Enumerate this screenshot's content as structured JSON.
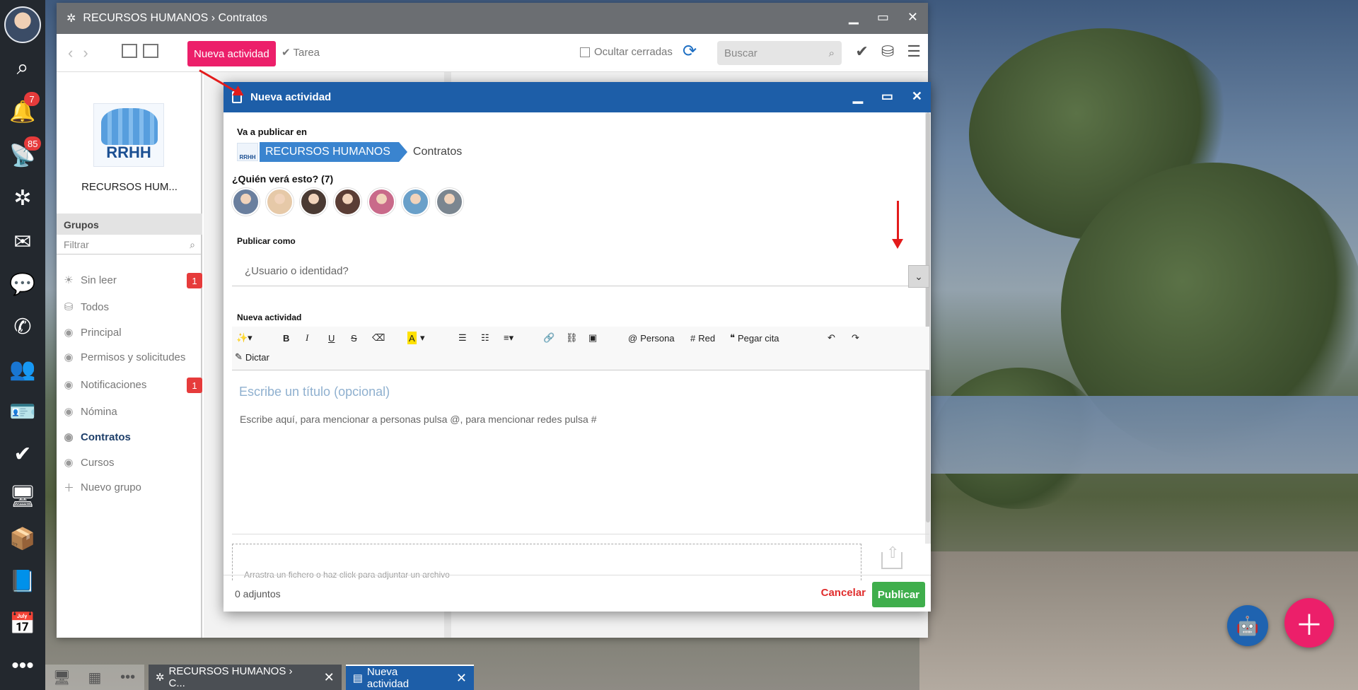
{
  "rail": {
    "notifications_badge": "7",
    "feeds_badge": "85"
  },
  "window": {
    "title": "RECURSOS HUMANOS › Contratos"
  },
  "toolbar": {
    "new_activity": "Nueva actividad",
    "task": "Tarea",
    "hide_closed": "Ocultar cerradas",
    "search_placeholder": "Buscar"
  },
  "groups": {
    "logo_text": "RRHH",
    "name": "RECURSOS HUM...",
    "header": "Grupos",
    "filter_placeholder": "Filtrar",
    "items": [
      {
        "label": "Sin leer",
        "badge": "1"
      },
      {
        "label": "Todos"
      },
      {
        "label": "Principal"
      },
      {
        "label": "Permisos y solicitudes"
      },
      {
        "label": "Notificaciones",
        "badge": "1"
      },
      {
        "label": "Nómina"
      },
      {
        "label": "Contratos"
      },
      {
        "label": "Cursos"
      },
      {
        "label": "Nuevo grupo"
      }
    ]
  },
  "dialog": {
    "title": "Nueva actividad",
    "publish_in_label": "Va a publicar en",
    "logo_text": "RRHH",
    "crumb_group": "RECURSOS HUMANOS",
    "crumb_sub": "Contratos",
    "who_sees": "¿Quién verá esto? (7)",
    "avatar_colors": [
      "#6a7f9e",
      "#e6c9a8",
      "#4a3a33",
      "#5a3d35",
      "#c96a8a",
      "#6aa0c9",
      "#7b8690"
    ],
    "publish_as_label": "Publicar como",
    "publish_as_placeholder": "¿Usuario o identidad?",
    "editor_label": "Nueva actividad",
    "editor": {
      "person": "Persona",
      "network": "Red",
      "paste_quote": "Pegar cita",
      "dictate": "Dictar"
    },
    "title_placeholder": "Escribe un título (opcional)",
    "body_placeholder": "Escribe aquí, para mencionar a personas pulsa @, para mencionar redes pulsa #",
    "dropzone": "Arrastra un fichero o haz click para adjuntar un archivo",
    "attachments": "0 adjuntos",
    "cancel": "Cancelar",
    "publish": "Publicar"
  },
  "taskbar": {
    "tab1": "RECURSOS HUMANOS › C...",
    "tab2": "Nueva actividad"
  }
}
